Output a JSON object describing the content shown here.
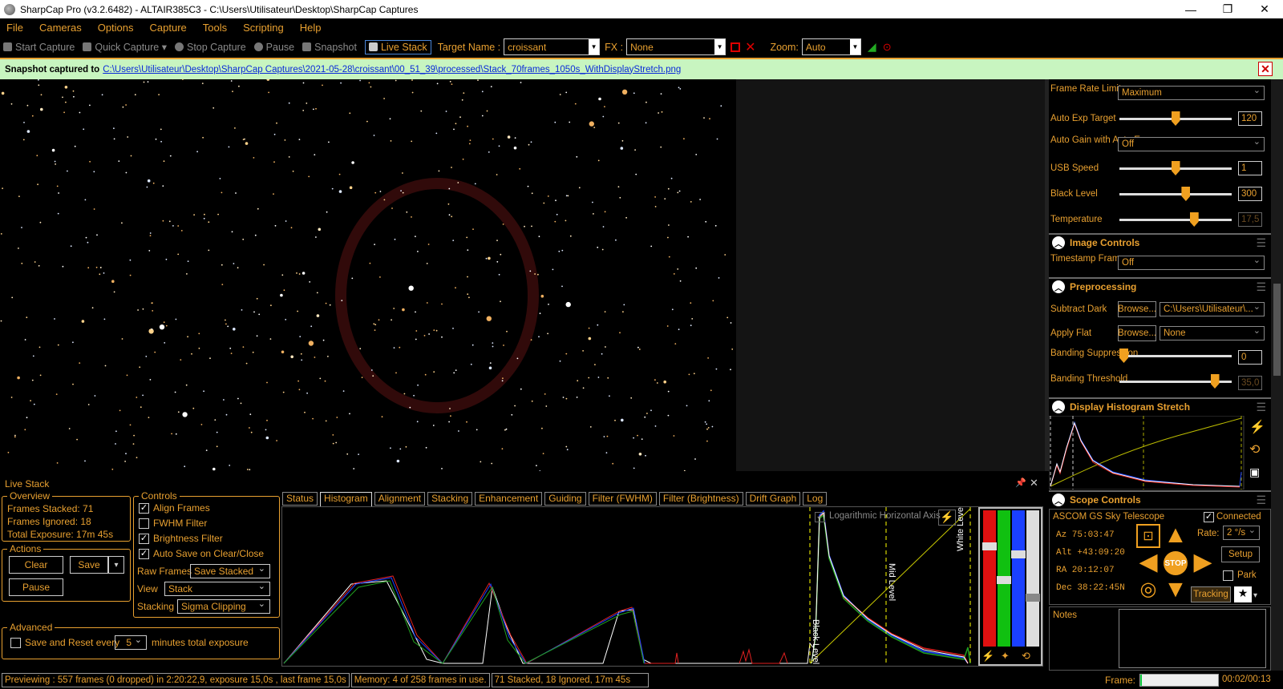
{
  "window": {
    "title": "SharpCap Pro (v3.2.6482) - ALTAIR385C3 - C:\\Users\\Utilisateur\\Desktop\\SharpCap Captures",
    "minimize": "—",
    "maximize": "❐",
    "close": "✕"
  },
  "menu": [
    "File",
    "Cameras",
    "Options",
    "Capture",
    "Tools",
    "Scripting",
    "Help"
  ],
  "toolbar": {
    "start_capture": "Start Capture",
    "quick_capture": "Quick Capture",
    "stop_capture": "Stop Capture",
    "pause": "Pause",
    "snapshot": "Snapshot",
    "live_stack": "Live Stack",
    "target_name_label": "Target Name :",
    "target_name_value": "croissant",
    "fx_label": "FX :",
    "fx_value": "None",
    "zoom_label": "Zoom:",
    "zoom_value": "Auto"
  },
  "notification": {
    "prefix": "Snapshot captured to",
    "path": "C:\\Users\\Utilisateur\\Desktop\\SharpCap Captures\\2021-05-28\\croissant\\00_51_39\\processed\\Stack_70frames_1050s_WithDisplayStretch.png"
  },
  "camera_controls": {
    "frame_rate_label": "Frame Rate Limit",
    "frame_rate_value": "Maximum",
    "auto_exp_label": "Auto Exp Target",
    "auto_exp_value": "120",
    "auto_exp_level": 0.5,
    "auto_gain_label": "Auto Gain with Auto Exposure",
    "auto_gain_value": "Off",
    "usb_label": "USB Speed",
    "usb_value": "1",
    "usb_level": 0.5,
    "black_level_label": "Black Level",
    "black_level_value": "300",
    "black_level_level": 0.6,
    "temperature_label": "Temperature",
    "temperature_value": "17,5",
    "temperature_level": 0.68
  },
  "image_controls": {
    "title": "Image Controls",
    "timestamp_label": "Timestamp Frames",
    "timestamp_value": "Off"
  },
  "preprocessing": {
    "title": "Preprocessing",
    "subtract_dark_label": "Subtract Dark",
    "browse": "Browse...",
    "dark_value": "C:\\Users\\Utilisateur\\...",
    "apply_flat_label": "Apply Flat",
    "flat_value": "None",
    "banding_supp_label": "Banding Suppression",
    "banding_supp_value": "0",
    "banding_supp_level": 0,
    "banding_thr_label": "Banding Threshold",
    "banding_thr_value": "35,0",
    "banding_thr_level": 0.88
  },
  "display_stretch": {
    "title": "Display Histogram Stretch"
  },
  "scope": {
    "title": "Scope Controls",
    "device": "ASCOM GS Sky Telescope",
    "connected_label": "Connected",
    "az": "Az  75:03:47",
    "alt": "Alt +43:09:20",
    "ra": "RA  20:12:07",
    "dec": "Dec 38:22:45N",
    "rate_label": "Rate:",
    "rate_value": "2 °/s",
    "setup": "Setup",
    "park": "Park",
    "stop": "STOP",
    "tracking": "Tracking",
    "notes_label": "Notes"
  },
  "live_stack": {
    "title": "Live Stack",
    "overview_title": "Overview",
    "frames_stacked": "Frames Stacked:  71",
    "frames_ignored": "Frames Ignored:   18",
    "total_exposure": "Total Exposure:    17m 45s",
    "actions_title": "Actions",
    "clear": "Clear",
    "save": "Save",
    "pause": "Pause",
    "controls_title": "Controls",
    "align_frames": "Align Frames",
    "fwhm_filter": "FWHM Filter",
    "brightness_filter": "Brightness Filter",
    "auto_save": "Auto Save on Clear/Close",
    "raw_frames_label": "Raw Frames",
    "raw_frames_value": "Save Stacked",
    "view_label": "View",
    "view_value": "Stack",
    "stacking_label": "Stacking",
    "stacking_value": "Sigma Clipping",
    "advanced_title": "Advanced",
    "save_reset_label": "Save and Reset every",
    "save_reset_value": "5",
    "minutes_label": "minutes total exposure",
    "tabs": [
      "Status",
      "Histogram",
      "Alignment",
      "Stacking",
      "Enhancement",
      "Guiding",
      "Filter (FWHM)",
      "Filter (Brightness)",
      "Drift Graph",
      "Log"
    ],
    "log_axis_label": "Logarithmic Horizontal Axis",
    "black_level_marker": "Black Level",
    "mid_level_marker": "Mid Level",
    "white_level_marker": "White Level"
  },
  "status": {
    "preview": "Previewing : 557 frames (0 dropped) in 2:20:22,9, exposure 15,0s , last frame 15,0s",
    "memory": "Memory: 4 of 258 frames in use.",
    "stack": "71 Stacked, 18 Ignored, 17m 45s",
    "frame_label": "Frame:",
    "frame_progress": 0.02,
    "frame_time": "00:02/00:13"
  },
  "colors": {
    "accent": "#e8a030",
    "notify_bg": "#c8f5c0",
    "link": "#0a2ad8"
  }
}
